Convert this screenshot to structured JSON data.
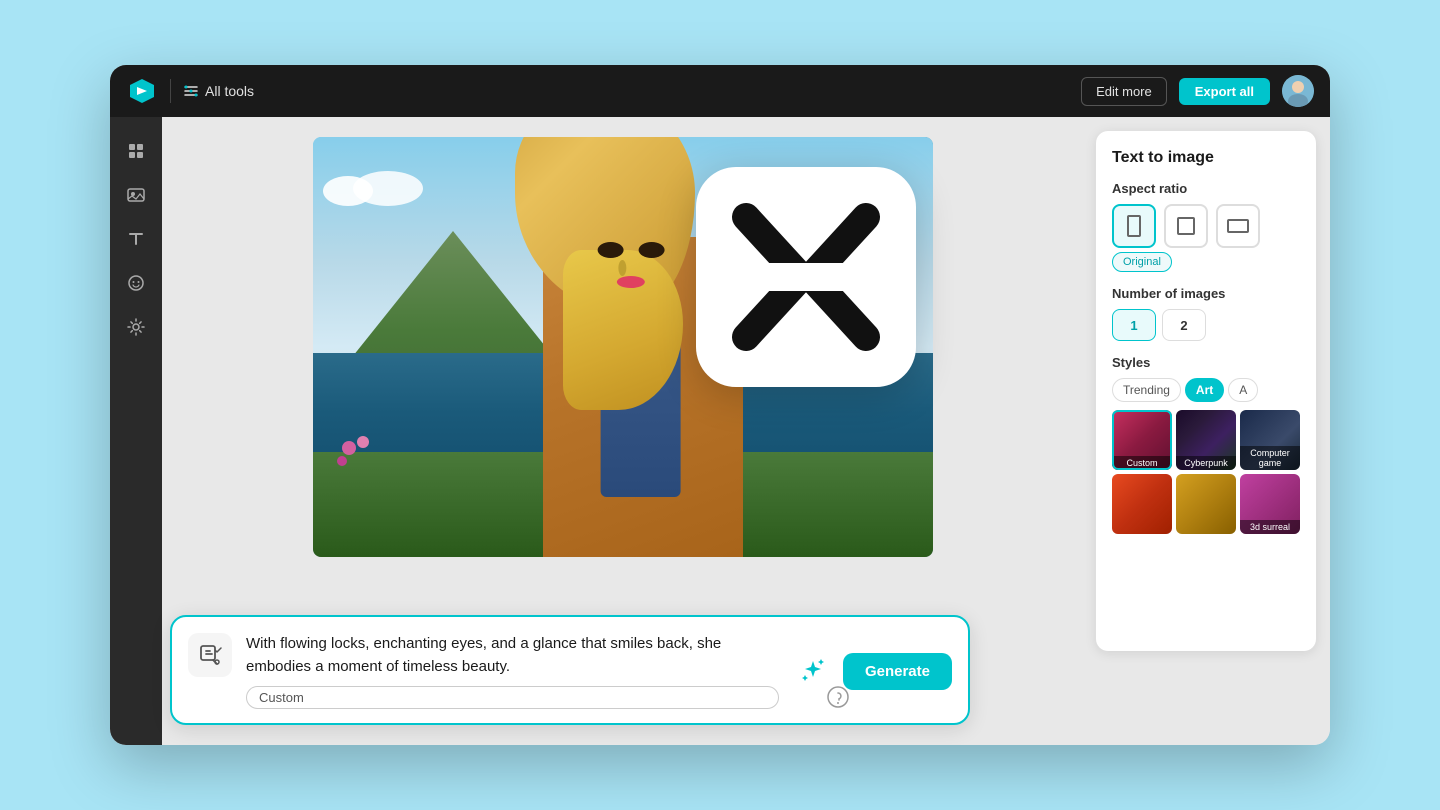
{
  "topbar": {
    "logo_label": "CapCut",
    "divider": true,
    "tools_label": "All tools",
    "edit_more_label": "Edit more",
    "export_all_label": "Export all"
  },
  "right_panel": {
    "title": "Text to image",
    "aspect_ratio_label": "Aspect ratio",
    "aspect_options": [
      "portrait",
      "square",
      "landscape"
    ],
    "aspect_active_tag": "Original",
    "num_images_label": "Number of images",
    "num_options": [
      "1",
      "2"
    ],
    "styles_label": "Styles",
    "style_tabs": [
      "Trending",
      "Art",
      "A"
    ],
    "active_style_tab": "Art",
    "style_thumbs": [
      {
        "id": "custom",
        "label": "Custom",
        "selected": true
      },
      {
        "id": "cyberpunk",
        "label": "Cyberpunk",
        "selected": false
      },
      {
        "id": "computer_game",
        "label": "Computer game",
        "selected": false
      },
      {
        "id": "row2a",
        "label": "",
        "selected": false
      },
      {
        "id": "row2b",
        "label": "",
        "selected": false
      },
      {
        "id": "row2c",
        "label": "3d surreal",
        "selected": false
      }
    ]
  },
  "prompt": {
    "text": "With flowing locks, enchanting eyes, and a glance that smiles back, she embodies a moment of timeless beauty.",
    "tag_label": "Custom",
    "generate_label": "Generate",
    "enhance_tooltip": "Enhance prompt"
  }
}
